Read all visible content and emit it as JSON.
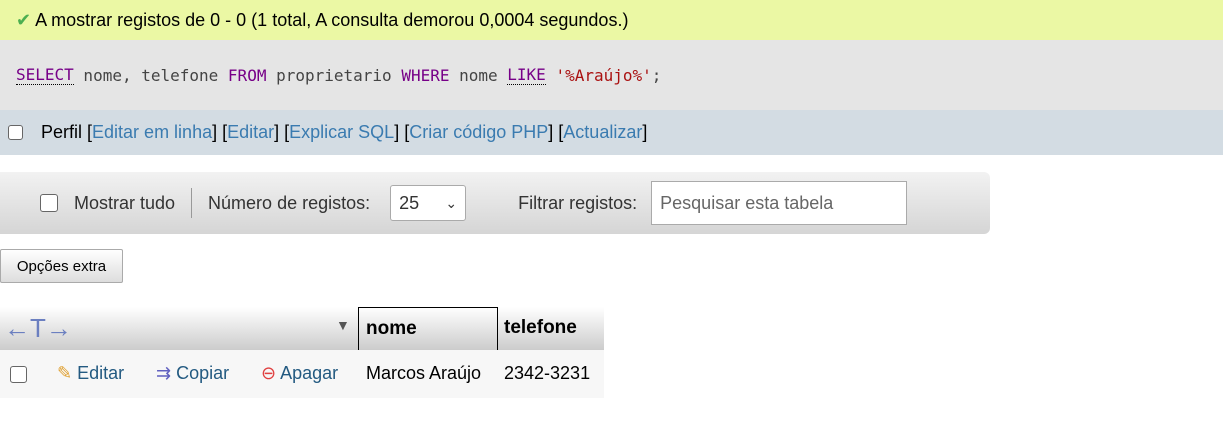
{
  "success": {
    "icon": "check-icon",
    "message": "A mostrar registos de 0 - 0 (1 total, A consulta demorou 0,0004 segundos.)"
  },
  "sql": {
    "t1": "SELECT",
    "t2": " nome, telefone ",
    "t3": "FROM",
    "t4": " proprietario ",
    "t5": "WHERE",
    "t6": " nome ",
    "t7": "LIKE",
    "t8": "'%Araújo%'",
    "t9": ";"
  },
  "perfil": {
    "label": "Perfil",
    "links": [
      "Editar em linha",
      "Editar",
      "Explicar SQL",
      "Criar código PHP",
      "Actualizar"
    ]
  },
  "nav": {
    "show_all": "Mostrar tudo",
    "rows_label": "Número de registos:",
    "rows_value": "25",
    "filter_label": "Filtrar registos:",
    "filter_placeholder": "Pesquisar esta tabela"
  },
  "extra_options": "Opções extra",
  "table": {
    "columns": [
      "nome",
      "telefone"
    ],
    "actions": {
      "edit": "Editar",
      "copy": "Copiar",
      "delete": "Apagar"
    },
    "rows": [
      {
        "nome": "Marcos Araújo",
        "telefone": "2342-3231"
      }
    ]
  }
}
